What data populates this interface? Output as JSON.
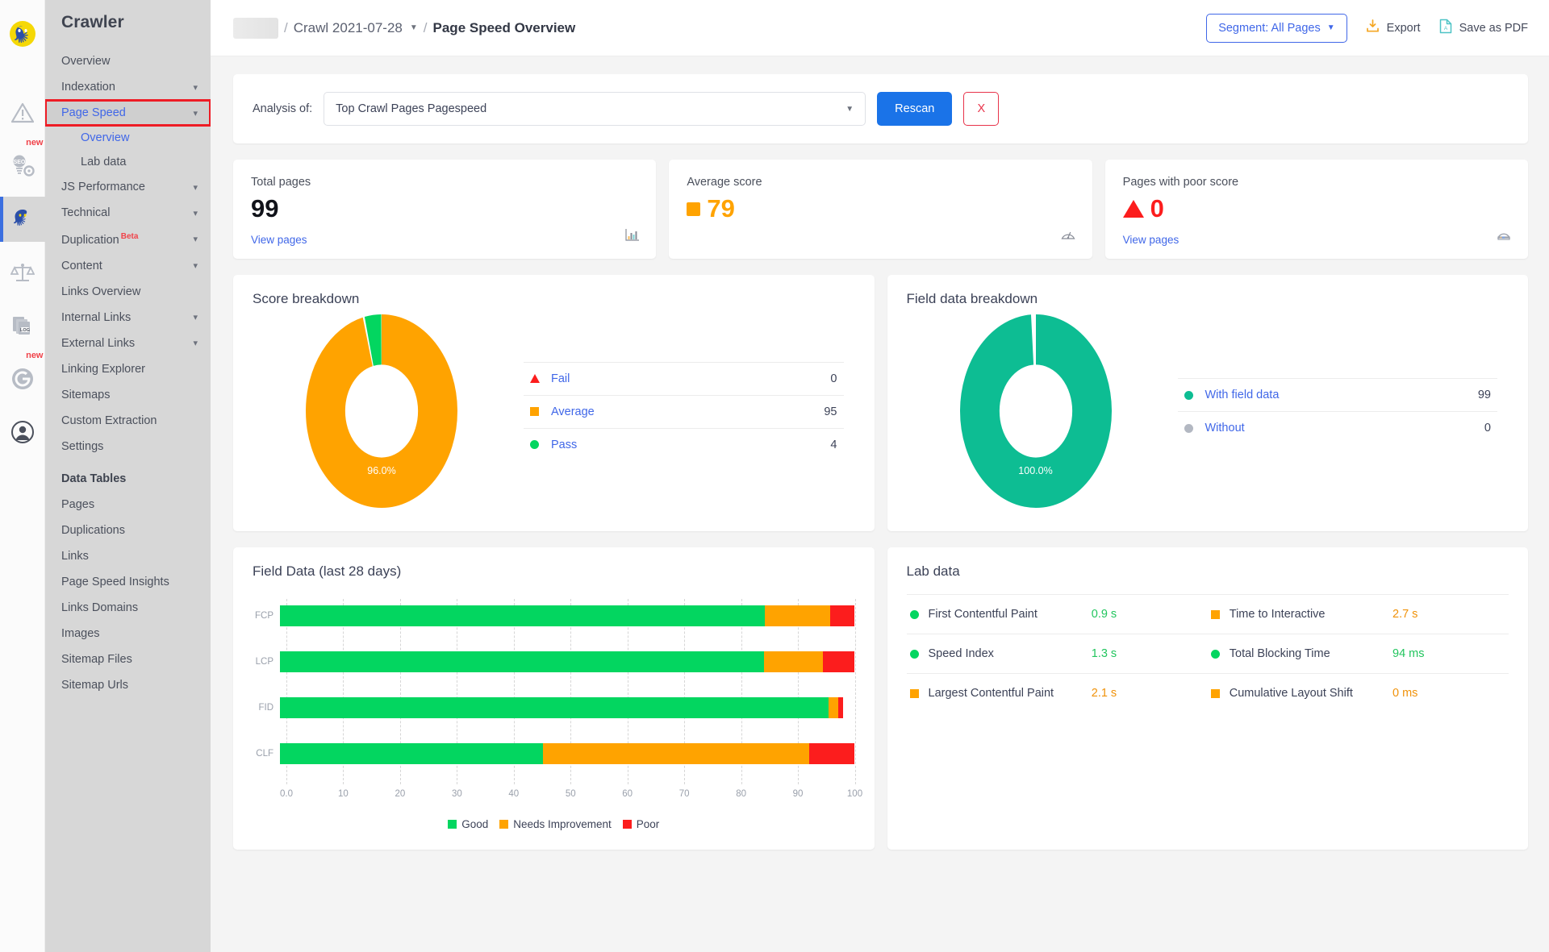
{
  "brand": "Crawler",
  "rail": [
    {
      "name": "octopus-logo-icon",
      "label": "logo"
    },
    {
      "name": "alert-triangle-icon",
      "label": "Alerts",
      "badge": null
    },
    {
      "name": "seo-bulb-gear-icon",
      "label": "SEO Tools",
      "badge": "new"
    },
    {
      "name": "octopus-crawler-icon",
      "label": "Crawler",
      "badge": null,
      "active": true
    },
    {
      "name": "scales-icon",
      "label": "Compare",
      "badge": null
    },
    {
      "name": "log-files-icon",
      "label": "Log Files",
      "badge": null
    },
    {
      "name": "google-g-icon",
      "label": "Google",
      "badge": "new"
    },
    {
      "name": "user-account-icon",
      "label": "Account",
      "badge": null
    }
  ],
  "sidebar": {
    "items": [
      {
        "label": "Overview",
        "expandable": false
      },
      {
        "label": "Indexation",
        "expandable": true
      },
      {
        "label": "Page Speed",
        "expandable": true,
        "highlighted": true
      },
      {
        "label": "JS Performance",
        "expandable": true
      },
      {
        "label": "Technical",
        "expandable": true
      },
      {
        "label": "Duplication",
        "expandable": true,
        "badge": "Beta"
      },
      {
        "label": "Content",
        "expandable": true
      },
      {
        "label": "Links Overview",
        "expandable": false
      },
      {
        "label": "Internal Links",
        "expandable": true
      },
      {
        "label": "External Links",
        "expandable": true
      },
      {
        "label": "Linking Explorer",
        "expandable": false
      },
      {
        "label": "Sitemaps",
        "expandable": false
      },
      {
        "label": "Custom Extraction",
        "expandable": false
      },
      {
        "label": "Settings",
        "expandable": false
      }
    ],
    "page_speed_sub": [
      {
        "label": "Overview",
        "active": true
      },
      {
        "label": "Lab data",
        "active": false
      }
    ],
    "data_tables_heading": "Data Tables",
    "data_tables": [
      {
        "label": "Pages"
      },
      {
        "label": "Duplications"
      },
      {
        "label": "Links"
      },
      {
        "label": "Page Speed Insights"
      },
      {
        "label": "Links Domains"
      },
      {
        "label": "Images"
      },
      {
        "label": "Sitemap Files"
      },
      {
        "label": "Sitemap Urls"
      }
    ]
  },
  "topbar": {
    "crumb_project": "",
    "crumb_crawl": "Crawl 2021-07-28",
    "crumb_current": "Page Speed Overview",
    "separator": "/",
    "segment_button": "Segment: All Pages",
    "export_label": "Export",
    "save_pdf_label": "Save as PDF"
  },
  "analysis": {
    "label": "Analysis of:",
    "selected": "Top Crawl Pages Pagespeed",
    "rescan_label": "Rescan",
    "cancel_label": "X"
  },
  "kpis": [
    {
      "title": "Total pages",
      "value": "99",
      "value_color": "#11131a",
      "link": "View pages",
      "icon": "bar-chart-icon",
      "marker": null
    },
    {
      "title": "Average score",
      "value": "79",
      "value_color": "#ffa300",
      "link": null,
      "icon": "gauge-icon",
      "marker": "square-orange"
    },
    {
      "title": "Pages with poor score",
      "value": "0",
      "value_color": "#fc1d1d",
      "link": "View pages",
      "icon": "speedometer-icon",
      "marker": "triangle-red"
    }
  ],
  "score_breakdown": {
    "title": "Score breakdown",
    "center_pct": "96.0%",
    "rows": [
      {
        "label": "Fail",
        "value": "0",
        "marker": "triangle",
        "color": "#fc1d1d"
      },
      {
        "label": "Average",
        "value": "95",
        "marker": "square",
        "color": "#ffa300"
      },
      {
        "label": "Pass",
        "value": "4",
        "marker": "circle",
        "color": "#03d660"
      }
    ]
  },
  "field_data_breakdown": {
    "title": "Field data breakdown",
    "center_pct": "100.0%",
    "rows": [
      {
        "label": "With field data",
        "value": "99",
        "marker": "circle",
        "color": "#0dbd93"
      },
      {
        "label": "Without",
        "value": "0",
        "marker": "circle",
        "color": "#b3b8c2"
      }
    ]
  },
  "lab_data": {
    "title": "Lab data",
    "rows": [
      [
        {
          "name": "First Contentful Paint",
          "value": "0.9 s",
          "marker": "circle",
          "color": "#03d660",
          "value_color": "#22c55e"
        },
        {
          "name": "Time to Interactive",
          "value": "2.7 s",
          "marker": "square",
          "color": "#ffa300",
          "value_color": "#f0920a"
        }
      ],
      [
        {
          "name": "Speed Index",
          "value": "1.3 s",
          "marker": "circle",
          "color": "#03d660",
          "value_color": "#22c55e"
        },
        {
          "name": "Total Blocking Time",
          "value": "94 ms",
          "marker": "circle",
          "color": "#03d660",
          "value_color": "#22c55e"
        }
      ],
      [
        {
          "name": "Largest Contentful Paint",
          "value": "2.1 s",
          "marker": "square",
          "color": "#ffa300",
          "value_color": "#f0920a"
        },
        {
          "name": "Cumulative Layout Shift",
          "value": "0 ms",
          "marker": "square",
          "color": "#ffa300",
          "value_color": "#f0920a"
        }
      ]
    ]
  },
  "chart_data": [
    {
      "type": "pie",
      "title": "Score breakdown",
      "labels": [
        "Average",
        "Pass",
        "Fail"
      ],
      "values": [
        95,
        4,
        0
      ],
      "percent": [
        96.0,
        4.0,
        0.0
      ],
      "colors": [
        "#ffa300",
        "#03d660",
        "#fc1d1d"
      ],
      "annotations": [
        "96.0%"
      ],
      "legend": "right",
      "donut": true
    },
    {
      "type": "pie",
      "title": "Field data breakdown",
      "labels": [
        "With field data",
        "Without"
      ],
      "values": [
        99,
        0
      ],
      "percent": [
        100.0,
        0.0
      ],
      "colors": [
        "#0dbd93",
        "#b3b8c2"
      ],
      "annotations": [
        "100.0%"
      ],
      "legend": "right",
      "donut": true
    },
    {
      "type": "bar",
      "orientation": "horizontal",
      "stacked": true,
      "title": "Field Data (last 28 days)",
      "categories": [
        "FCP",
        "LCP",
        "FID",
        "CLF"
      ],
      "series": [
        {
          "name": "Good",
          "color": "#03d660",
          "values": [
            84.4,
            84.2,
            95.5,
            45.8
          ]
        },
        {
          "name": "Needs Improvement",
          "color": "#ffa300",
          "values": [
            11.3,
            10.2,
            1.6,
            46.3
          ]
        },
        {
          "name": "Poor",
          "color": "#fc1d1d",
          "values": [
            4.3,
            5.6,
            0.9,
            7.9
          ]
        }
      ],
      "xlabel": "",
      "ylabel": "",
      "xlim": [
        0,
        100
      ],
      "xticks": [
        "0.0",
        "10",
        "20",
        "30",
        "40",
        "50",
        "60",
        "70",
        "80",
        "90",
        "100"
      ],
      "grid": true,
      "legend": "bottom"
    }
  ]
}
